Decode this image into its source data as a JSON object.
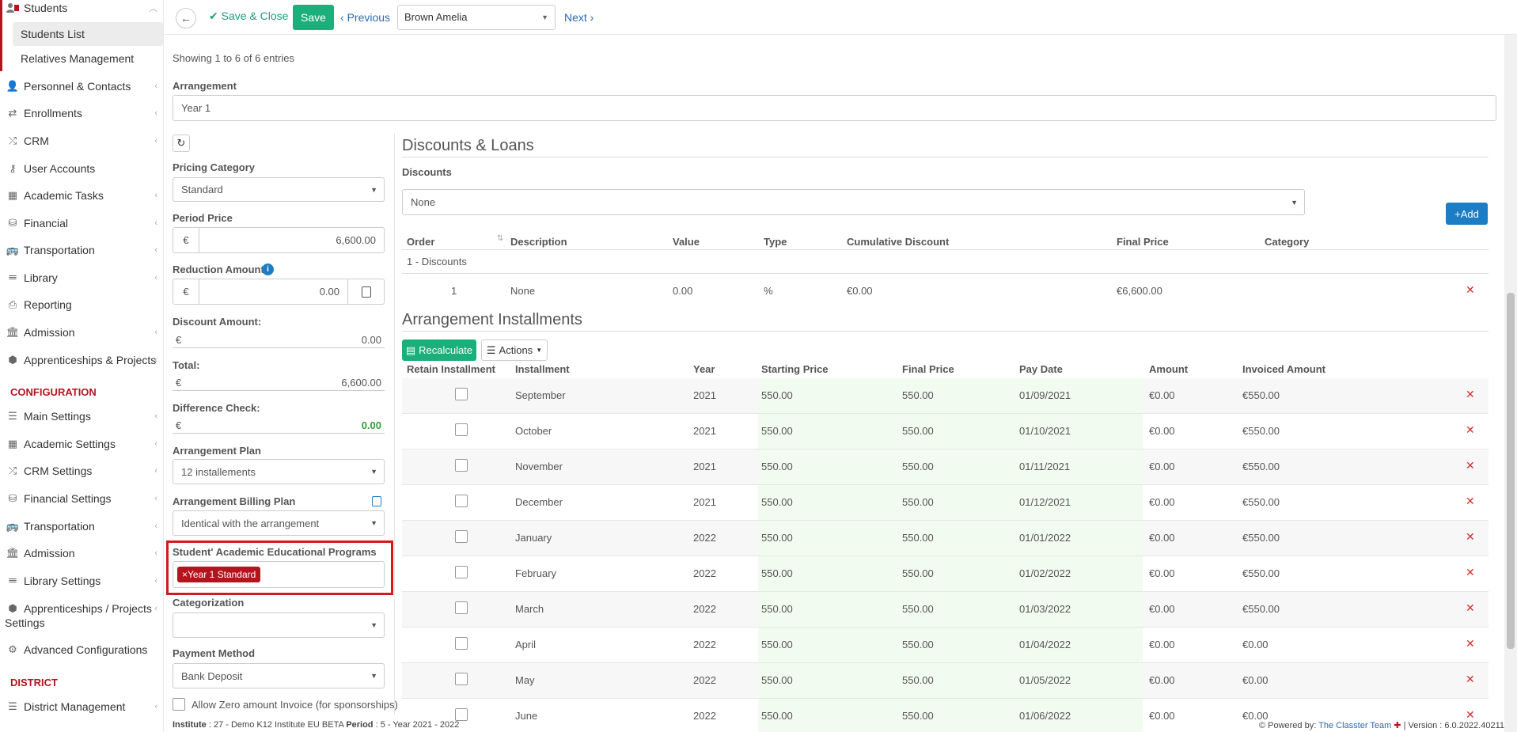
{
  "sidebar": {
    "students": "Students",
    "students_list": "Students List",
    "relatives": "Relatives Management",
    "items": [
      {
        "label": "Personnel & Contacts",
        "icon": "users-icon"
      },
      {
        "label": "Enrollments",
        "icon": "exchange-icon"
      },
      {
        "label": "CRM",
        "icon": "shuffle-icon"
      },
      {
        "label": "User Accounts",
        "icon": "key-icon"
      },
      {
        "label": "Academic Tasks",
        "icon": "grid-icon"
      },
      {
        "label": "Financial",
        "icon": "coins-icon"
      },
      {
        "label": "Transportation",
        "icon": "bus-icon"
      },
      {
        "label": "Library",
        "icon": "books-icon"
      },
      {
        "label": "Reporting",
        "icon": "printer-icon"
      },
      {
        "label": "Admission",
        "icon": "institution-icon"
      },
      {
        "label": "Apprenticeships & Projects",
        "icon": "cube-icon"
      }
    ],
    "config_header": "CONFIGURATION",
    "config_items": [
      {
        "label": "Main Settings",
        "icon": "sliders-icon"
      },
      {
        "label": "Academic Settings",
        "icon": "grid-icon"
      },
      {
        "label": "CRM Settings",
        "icon": "shuffle-icon"
      },
      {
        "label": "Financial Settings",
        "icon": "coins-icon"
      },
      {
        "label": "Transportation",
        "icon": "bus-icon"
      },
      {
        "label": "Admission",
        "icon": "institution-icon"
      },
      {
        "label": "Library Settings",
        "icon": "books-icon"
      },
      {
        "label": "Apprenticeships / Projects",
        "icon": "cube-icon"
      },
      {
        "label": "Advanced Configurations",
        "icon": "cogs-icon"
      }
    ],
    "apprentice_line2": "Settings",
    "district_header": "DISTRICT",
    "district_items": [
      {
        "label": "District Management",
        "icon": "list-icon"
      }
    ]
  },
  "toolbar": {
    "save_close": "Save & Close",
    "save": "Save",
    "previous": "Previous",
    "student": "Brown Amelia",
    "next": "Next"
  },
  "main": {
    "showing": "Showing 1 to 6 of 6 entries",
    "arrangement_label": "Arrangement",
    "arrangement_value": "Year 1",
    "pricing_category_label": "Pricing Category",
    "pricing_category_value": "Standard",
    "period_price_label": "Period Price",
    "currency": "€",
    "period_price_value": "6,600.00",
    "reduction_label": "Reduction Amount",
    "reduction_value": "0.00",
    "discount_amount_label": "Discount Amount:",
    "discount_amount_value": "0.00",
    "total_label": "Total:",
    "total_value": "6,600.00",
    "difference_label": "Difference Check:",
    "difference_value": "0.00",
    "plan_label": "Arrangement Plan",
    "plan_value": "12 installements",
    "billing_label": "Arrangement Billing Plan",
    "billing_value": "Identical with the arrangement",
    "programs_label": "Student' Academic Educational Programs",
    "programs_tag": "Year 1 Standard",
    "categorization_label": "Categorization",
    "payment_label": "Payment Method",
    "payment_value": "Bank Deposit",
    "zero_invoice": "Allow Zero amount Invoice (for sponsorships)"
  },
  "discounts": {
    "title": "Discounts & Loans",
    "label": "Discounts",
    "select_value": "None",
    "add": "Add",
    "headers": [
      "Order",
      "Description",
      "Value",
      "Type",
      "Cumulative Discount",
      "Final Price",
      "Category"
    ],
    "group": "1 - Discounts",
    "row": [
      "1",
      "None",
      "0.00",
      "%",
      "€0.00",
      "€6,600.00",
      ""
    ]
  },
  "installments": {
    "title": "Arrangement Installments",
    "recalculate": "Recalculate",
    "actions": "Actions",
    "headers": [
      "Retain Installment",
      "Installment",
      "Year",
      "Starting Price",
      "Final Price",
      "Pay Date",
      "Amount",
      "Invoiced Amount"
    ],
    "rows": [
      [
        "September",
        "2021",
        "550.00",
        "550.00",
        "01/09/2021",
        "€0.00",
        "€550.00"
      ],
      [
        "October",
        "2021",
        "550.00",
        "550.00",
        "01/10/2021",
        "€0.00",
        "€550.00"
      ],
      [
        "November",
        "2021",
        "550.00",
        "550.00",
        "01/11/2021",
        "€0.00",
        "€550.00"
      ],
      [
        "December",
        "2021",
        "550.00",
        "550.00",
        "01/12/2021",
        "€0.00",
        "€550.00"
      ],
      [
        "January",
        "2022",
        "550.00",
        "550.00",
        "01/01/2022",
        "€0.00",
        "€550.00"
      ],
      [
        "February",
        "2022",
        "550.00",
        "550.00",
        "01/02/2022",
        "€0.00",
        "€550.00"
      ],
      [
        "March",
        "2022",
        "550.00",
        "550.00",
        "01/03/2022",
        "€0.00",
        "€550.00"
      ],
      [
        "April",
        "2022",
        "550.00",
        "550.00",
        "01/04/2022",
        "€0.00",
        "€0.00"
      ],
      [
        "May",
        "2022",
        "550.00",
        "550.00",
        "01/05/2022",
        "€0.00",
        "€0.00"
      ],
      [
        "June",
        "2022",
        "550.00",
        "550.00",
        "01/06/2022",
        "€0.00",
        "€0.00"
      ]
    ]
  },
  "footer": {
    "institute_label": "Institute",
    "institute_value": ": 27 - Demo K12 Institute EU BETA",
    "period_label": "Period",
    "period_value": ": 5 - Year 2021 - 2022",
    "powered": "Powered by:",
    "team": "The Classter Team",
    "version": "| Version : 6.0.2022.40211"
  },
  "colors": {
    "accent_green": "#1aaf7b",
    "accent_blue": "#1c7cc4",
    "brand_red": "#b5141f"
  }
}
